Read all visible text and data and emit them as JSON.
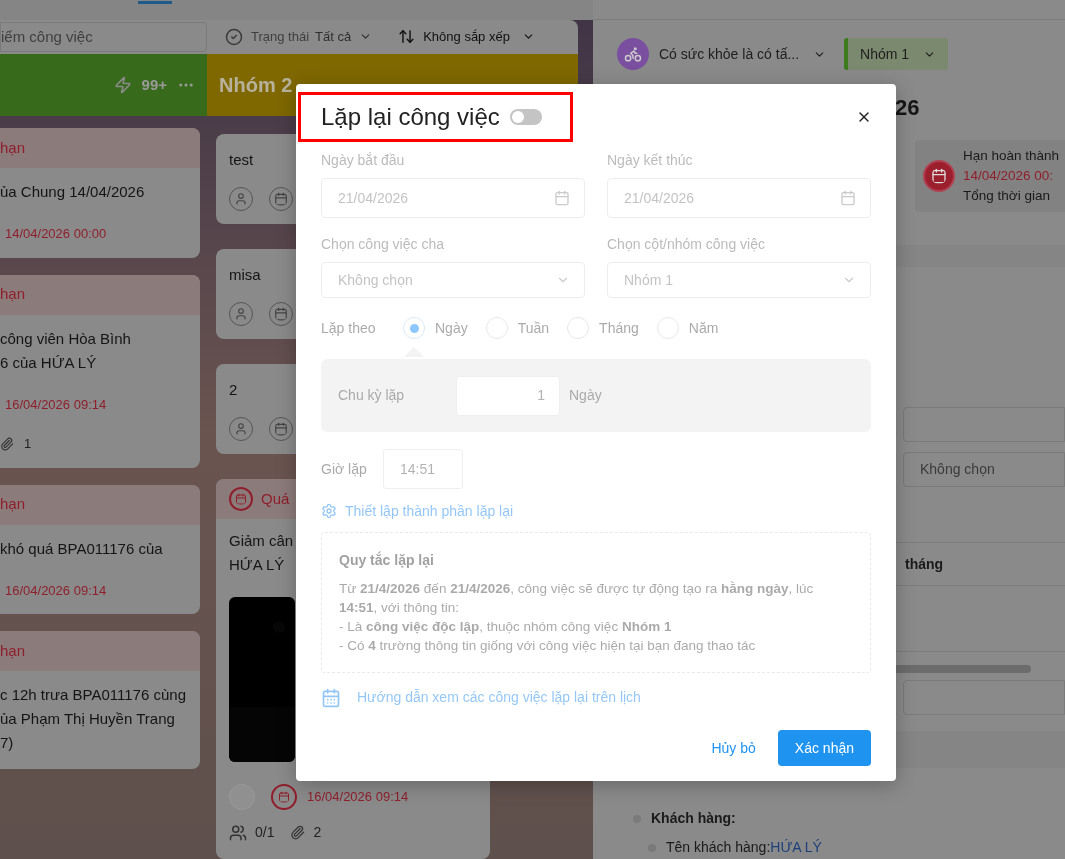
{
  "toolbar": {
    "search_value": "iểm công việc",
    "status_label": "Trạng thái",
    "status_value": "Tất cả",
    "sort_label": "Không sắp xếp"
  },
  "columns": [
    {
      "kind": "counter",
      "color": "#386a1c",
      "count": "99+",
      "cards": [
        {
          "kind": "overdue",
          "header": "hạn",
          "lines": [
            "ủa Chung 14/04/2026"
          ],
          "date": "14/04/2026 00:00"
        },
        {
          "kind": "overdue",
          "header": "hạn",
          "lines": [
            "công viên Hòa Bình",
            "6 của HỨA LÝ"
          ],
          "date": "16/04/2026 09:14",
          "attachments": "1"
        },
        {
          "kind": "overdue",
          "header": "hạn",
          "lines": [
            "khó quá BPA011176 của"
          ],
          "date": "16/04/2026 09:14"
        },
        {
          "kind": "overdue",
          "header": "hạn",
          "lines": [
            "c 12h trưa BPA011176 cùng",
            "ủa Phạm Thị Huyền Trang",
            "7)"
          ]
        }
      ]
    },
    {
      "kind": "titled",
      "color": "#7f6800",
      "title": "Nhóm 2",
      "cards": [
        {
          "kind": "simple",
          "title": "test"
        },
        {
          "kind": "simple",
          "title": "misa"
        },
        {
          "kind": "simple",
          "title": "2"
        },
        {
          "kind": "rich",
          "header": "Quá",
          "lines": [
            "Giảm cân",
            "HỨA LÝ"
          ],
          "date": "16/04/2026 09:14",
          "checklist": "0/1",
          "attachments": "2"
        }
      ]
    }
  ],
  "detail": {
    "project": "Có sức khỏe là có tấ...",
    "group": "Nhóm 1",
    "title_tail": "26",
    "deadline_label": "Hạn hoàn thành",
    "deadline_date": "14/04/2026 00:",
    "total_label": "Tổng thời gian",
    "select_value": "Không chọn",
    "period_label": "tháng",
    "customer_label": "Khách hàng:",
    "customer_name_label": "Tên khách hàng:",
    "customer_name": "HỨA LÝ"
  },
  "modal": {
    "title": "Lặp lại công việc",
    "on": false,
    "highlighted": true,
    "fields": [
      {
        "label": "Ngày bắt đầu",
        "value": "21/04/2026",
        "kind": "date"
      },
      {
        "label": "Ngày kết thúc",
        "value": "21/04/2026",
        "kind": "date"
      },
      {
        "label": "Chọn công việc cha",
        "value": "Không chọn",
        "kind": "select"
      },
      {
        "label": "Chọn cột/nhóm công việc",
        "value": "Nhóm 1",
        "kind": "select"
      }
    ],
    "repeat_by": {
      "label": "Lặp theo",
      "options": [
        {
          "label": "Ngày",
          "selected": true
        },
        {
          "label": "Tuần",
          "selected": false
        },
        {
          "label": "Tháng",
          "selected": false
        },
        {
          "label": "Năm",
          "selected": false
        }
      ]
    },
    "cycle": {
      "label": "Chu kỳ lặp",
      "value": "1",
      "unit": "Ngày"
    },
    "time": {
      "label": "Giờ lặp",
      "value": "14:51"
    },
    "settings_link": "Thiết lập thành phần lặp lại",
    "rule": {
      "title": "Quy tắc lặp lại",
      "lines": [
        "Từ **21/4/2026** đến **21/4/2026**, công việc sẽ được tự động tạo ra **hằng ngày**, lúc **14:51**, với thông tin:",
        "- Là **công việc độc lập**, thuộc nhóm công việc **Nhóm 1**",
        "- Có **4** trường thông tin giống với công việc hiện tại bạn đang thao tác"
      ]
    },
    "calendar_link": "Hướng dẫn xem các công việc lặp lại trên lịch",
    "buttons": [
      {
        "label": "Hủy bỏ",
        "kind": "text"
      },
      {
        "label": "Xác nhận",
        "kind": "primary"
      }
    ]
  }
}
